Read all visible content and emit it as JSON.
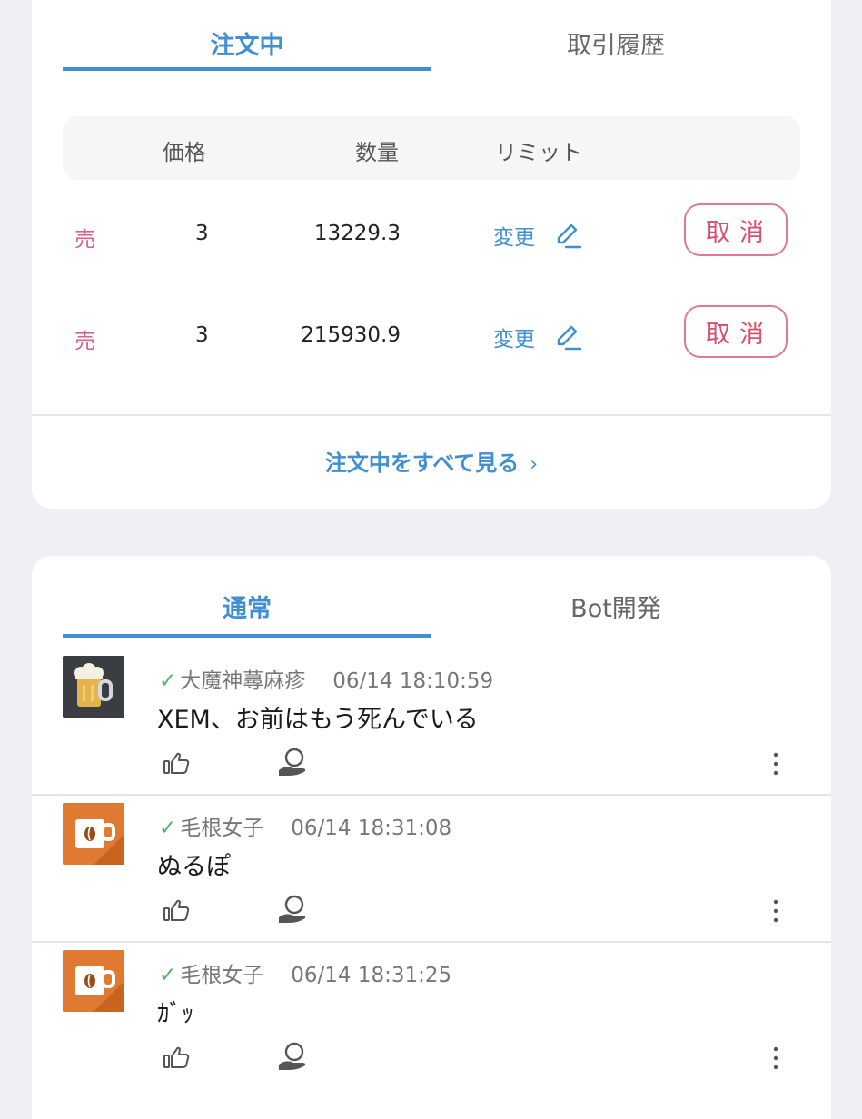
{
  "orders": {
    "tabs": [
      {
        "label": "注文中",
        "active": true
      },
      {
        "label": "取引履歴",
        "active": false
      }
    ],
    "columns": [
      "価格",
      "数量",
      "リミット"
    ],
    "rows": [
      {
        "side": "売",
        "price": "3",
        "quantity": "13229.3",
        "limit_label": "変更",
        "cancel_label": "取消"
      },
      {
        "side": "売",
        "price": "3",
        "quantity": "215930.9",
        "limit_label": "変更",
        "cancel_label": "取消"
      }
    ],
    "see_all_label": "注文中をすべて見る"
  },
  "chat": {
    "tabs": [
      {
        "label": "通常",
        "active": true
      },
      {
        "label": "Bot開発",
        "active": false
      }
    ],
    "messages": [
      {
        "username": "大魔神蕁麻疹",
        "time": "06/14 18:10:59",
        "text": "XEM、お前はもう死んでいる",
        "avatar": "beer-mug-icon"
      },
      {
        "username": "毛根女子",
        "time": "06/14 18:31:08",
        "text": "ぬるぽ",
        "avatar": "coffee-cup-icon"
      },
      {
        "username": "毛根女子",
        "time": "06/14 18:31:25",
        "text": "ｶﾞｯ",
        "avatar": "coffee-cup-icon"
      }
    ]
  },
  "colors": {
    "accent": "#3f8fd2",
    "sell": "#d6628f",
    "cancel": "#d9506f",
    "verified": "#4fb26a",
    "background": "#eef0f4"
  }
}
